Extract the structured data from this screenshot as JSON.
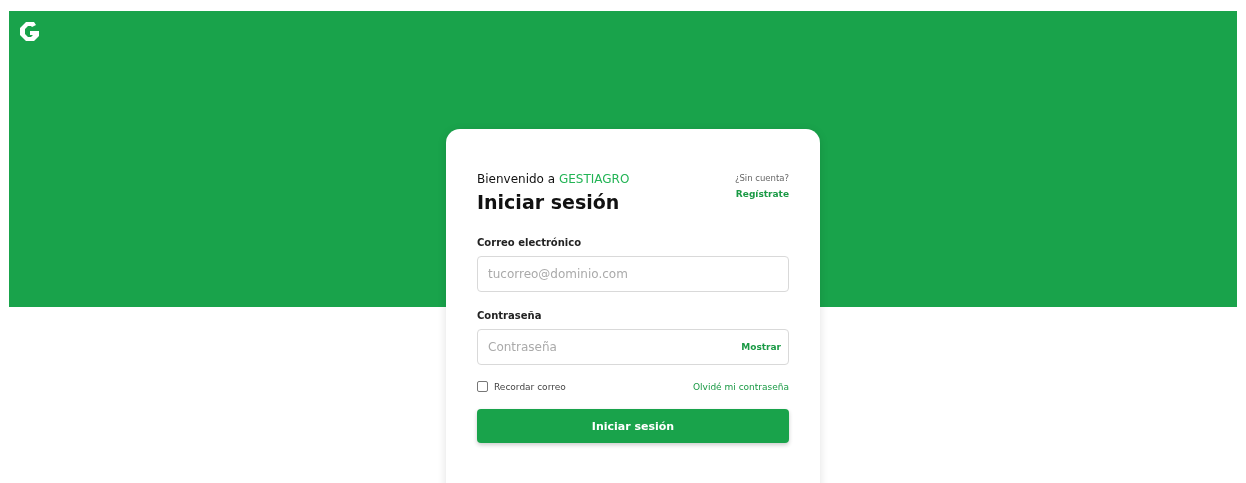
{
  "welcome": {
    "prefix": "Bienvenido a",
    "brand": "GESTIAGRO"
  },
  "title": "Iniciar sesión",
  "signup": {
    "question": "¿Sin cuenta?",
    "link": "Regístrate"
  },
  "email": {
    "label": "Correo electrónico",
    "placeholder": "tucorreo@dominio.com"
  },
  "password": {
    "label": "Contraseña",
    "placeholder": "Contraseña",
    "toggle": "Mostrar"
  },
  "remember": {
    "label": "Recordar correo",
    "checked": false
  },
  "forgot": "Olvidé mi contraseña",
  "submit": "Iniciar sesión"
}
